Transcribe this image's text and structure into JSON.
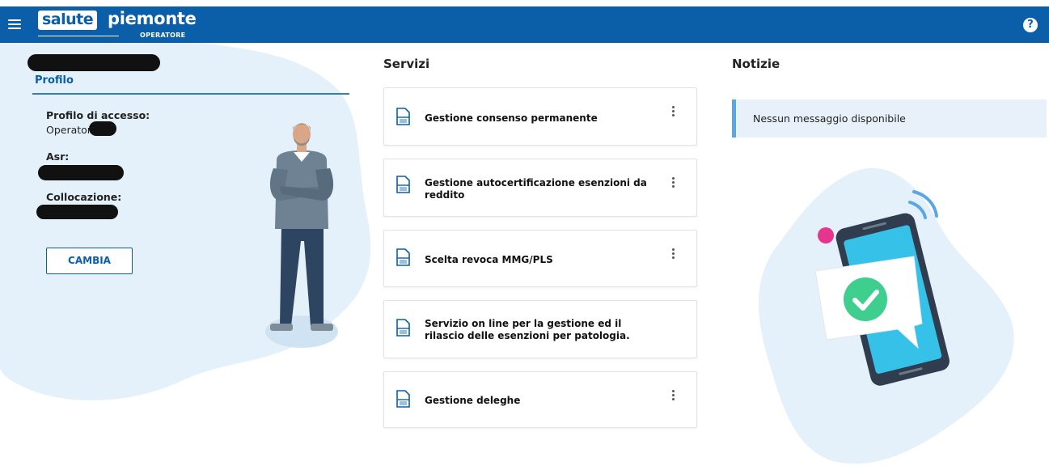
{
  "header": {
    "brand_box": "salute",
    "brand_text": "piemonte",
    "brand_sub": "OPERATORE",
    "help_glyph": "?"
  },
  "profile": {
    "section_title": "Profilo",
    "access_label": "Profilo di accesso:",
    "access_value": "Operator",
    "asr_label": "Asr:",
    "collocation_label": "Collocazione:",
    "change_button": "CAMBIA"
  },
  "services": {
    "title": "Servizi",
    "items": [
      {
        "label": "Gestione consenso permanente",
        "icon": "document-icon",
        "has_menu": true
      },
      {
        "label": "Gestione autocertificazione esenzioni da reddito",
        "icon": "document-icon",
        "has_menu": true
      },
      {
        "label": "Scelta revoca MMG/PLS",
        "icon": "document-icon",
        "has_menu": true
      },
      {
        "label": "Servizio on line per la gestione ed il rilascio delle esenzioni per patologia.",
        "icon": "document-icon",
        "has_menu": false
      },
      {
        "label": "Gestione deleghe",
        "icon": "document-icon",
        "has_menu": true
      }
    ]
  },
  "news": {
    "title": "Notizie",
    "empty_message": "Nessun messaggio disponibile"
  },
  "colors": {
    "brand_blue": "#0a5fa8",
    "accent_light_blue": "#5aa7e8",
    "blob_bg": "#e4f1fb",
    "check_green": "#3ecf8e",
    "dot_pink": "#e5358f"
  }
}
